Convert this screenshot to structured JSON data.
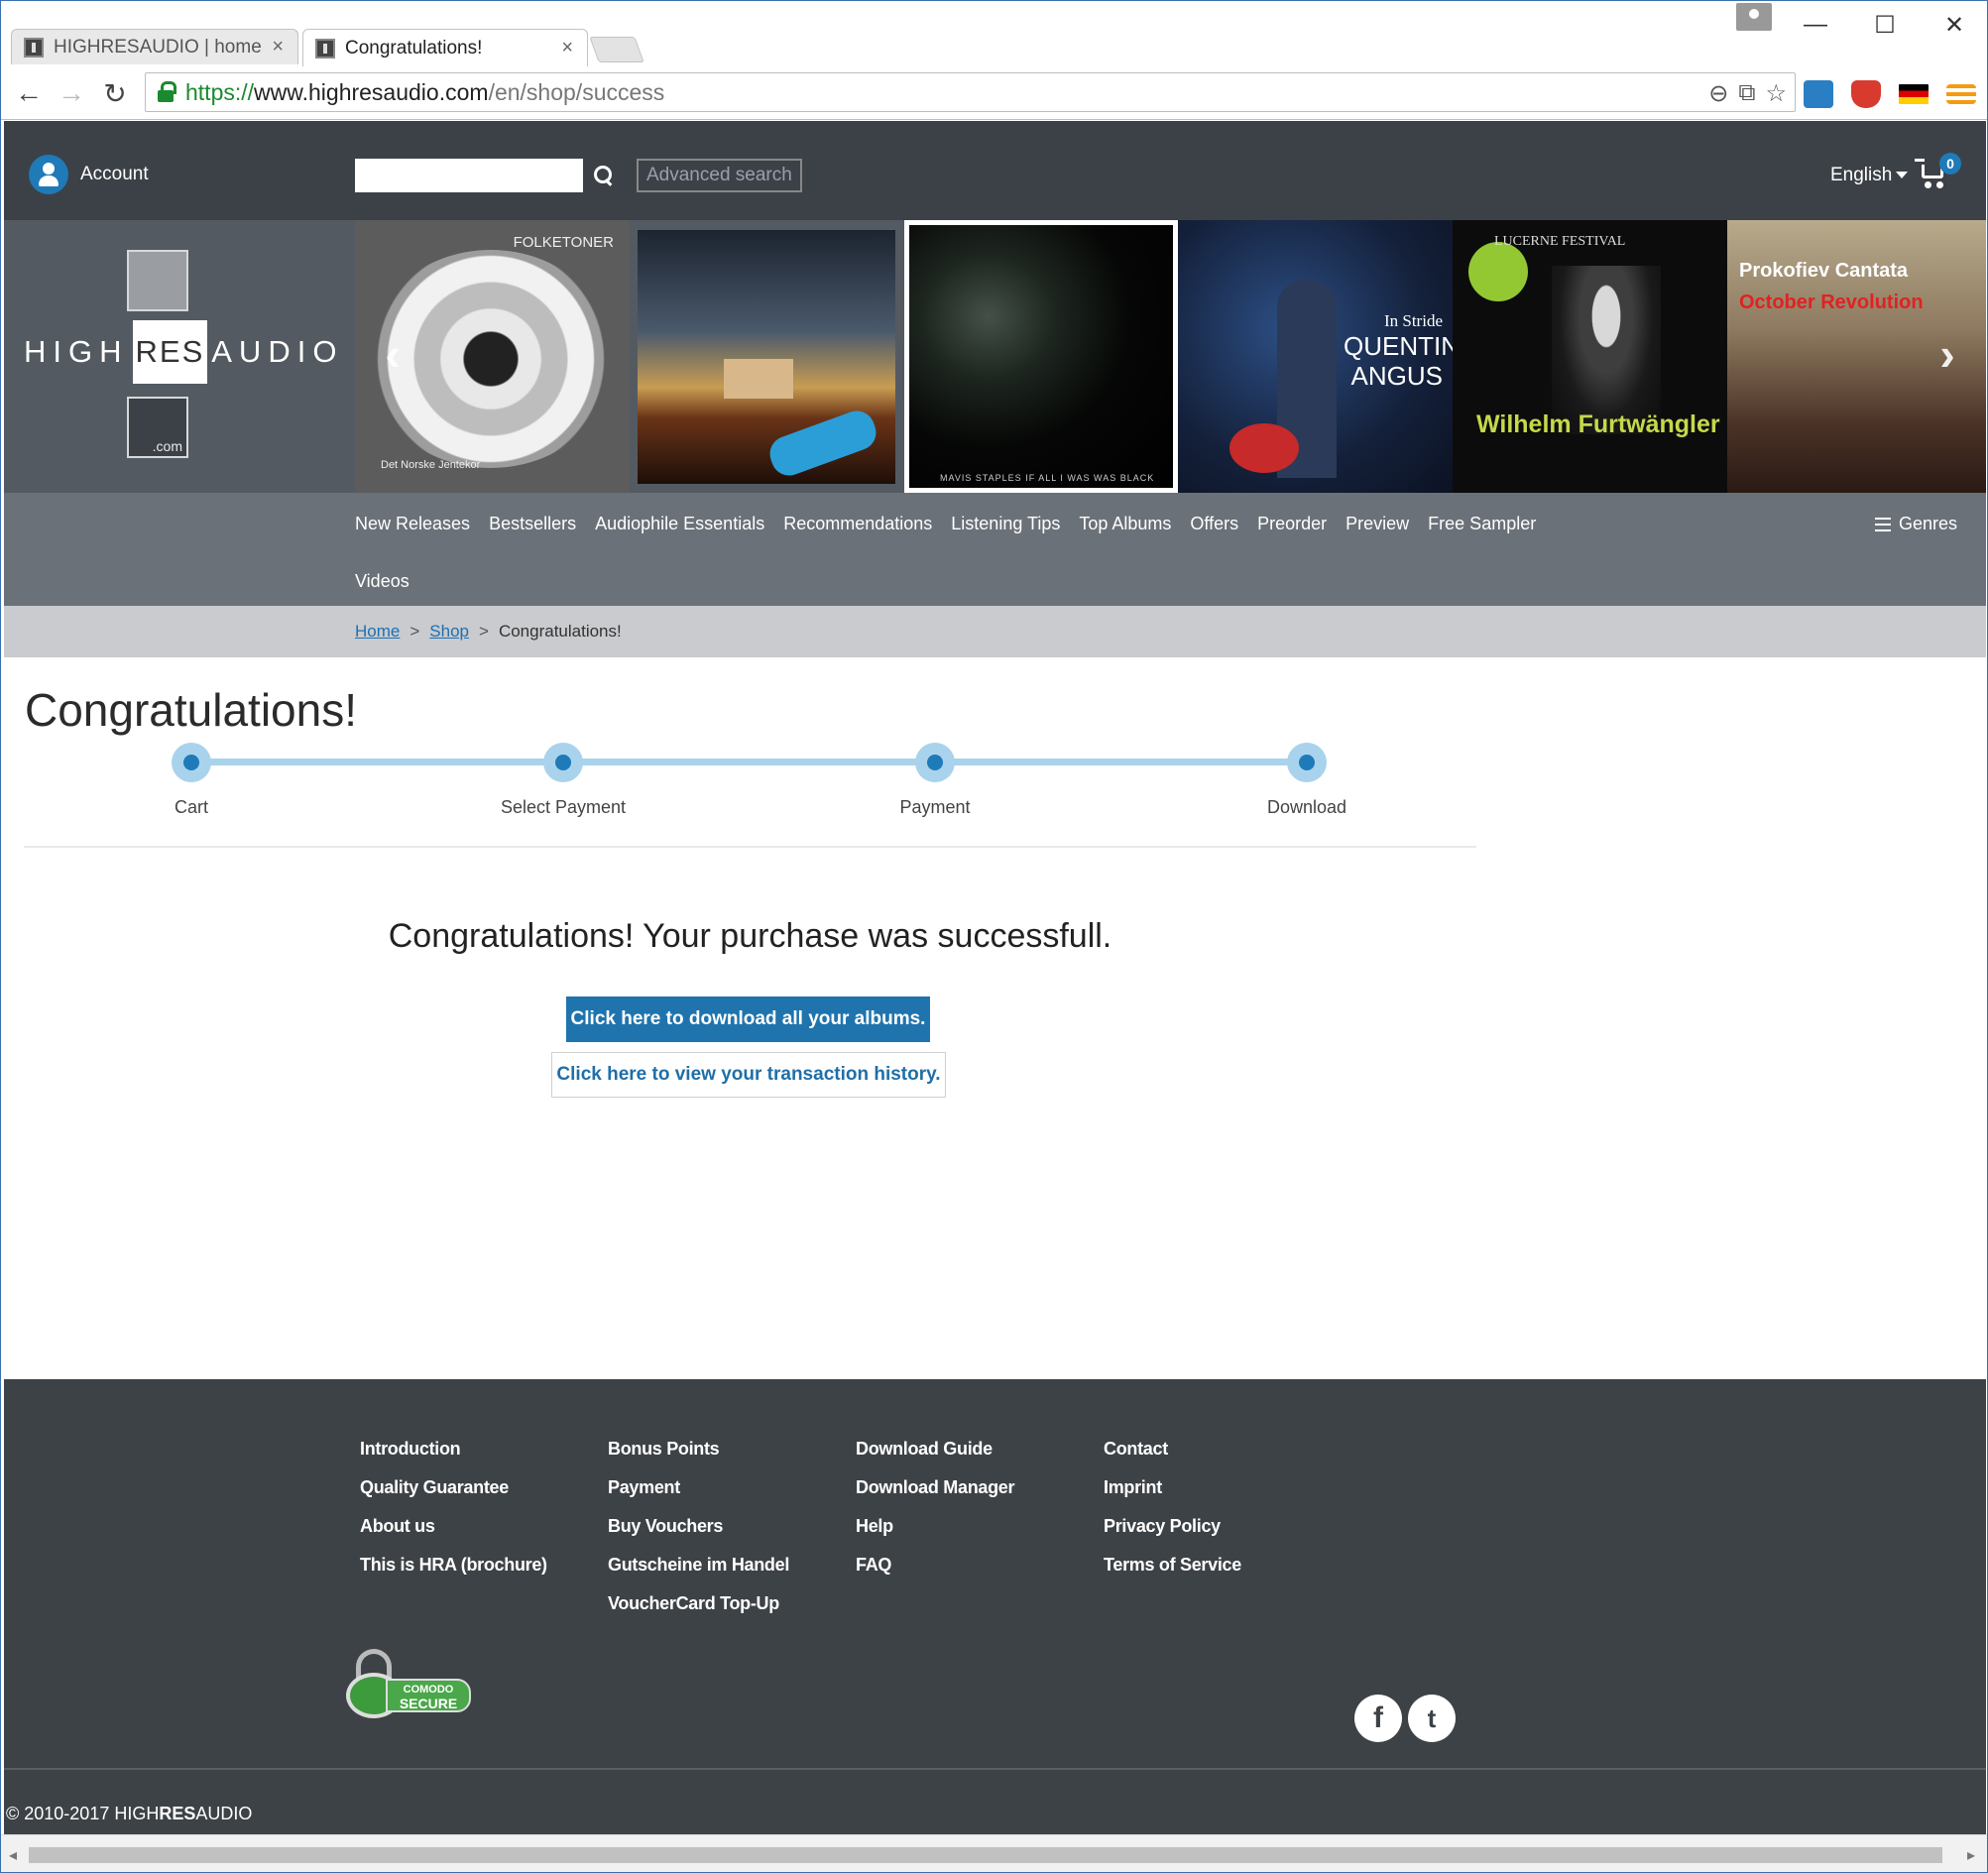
{
  "browser": {
    "tabs": [
      {
        "title": "HIGHRESAUDIO | home of",
        "close": "×"
      },
      {
        "title": "Congratulations!",
        "close": "×"
      }
    ],
    "window_controls": {
      "minimize": "—",
      "maximize": "☐",
      "close": "✕"
    },
    "url": {
      "scheme": "https://",
      "host": "www.highresaudio.com",
      "path": "/en/shop/success"
    }
  },
  "header": {
    "account_label": "Account",
    "search_placeholder": "",
    "advanced_search": "Advanced search",
    "language": "English",
    "cart_count": "0"
  },
  "logo": {
    "left": "HIGH",
    "mid": "RES",
    "right": "AUDIO",
    "dotcom": ".com"
  },
  "carousel": [
    {
      "title": "FOLKETONER",
      "subtitle": "Det Norske Jentekor"
    },
    {
      "title": "",
      "subtitle": ""
    },
    {
      "title": "MAVIS STAPLES  IF ALL I WAS WAS BLACK",
      "subtitle": ""
    },
    {
      "title": "In Stride",
      "subtitle": "QUENTIN ANGUS"
    },
    {
      "title": "LUCERNE FESTIVAL",
      "subtitle": "Wilhelm Furtwängler"
    },
    {
      "title": "Prokofiev Cantata",
      "subtitle": "October Revolution"
    }
  ],
  "nav": {
    "items": [
      "New Releases",
      "Bestsellers",
      "Audiophile Essentials",
      "Recommendations",
      "Listening Tips",
      "Top Albums",
      "Offers",
      "Preorder",
      "Preview",
      "Free Sampler",
      "Videos"
    ],
    "genres": "Genres"
  },
  "breadcrumb": {
    "home": "Home",
    "shop": "Shop",
    "current": "Congratulations!",
    "sep": ">"
  },
  "page": {
    "title": "Congratulations!",
    "steps": [
      "Cart",
      "Select Payment",
      "Payment",
      "Download"
    ],
    "message": "Congratulations! Your purchase was successfull.",
    "download_button": "Click here to download all your albums.",
    "history_button": "Click here to view your transaction history."
  },
  "footer": {
    "col1": [
      "Introduction",
      "Quality Guarantee",
      "About us",
      "This is HRA (brochure)"
    ],
    "col2": [
      "Bonus Points",
      "Payment",
      "Buy Vouchers",
      "Gutscheine im Handel",
      "VoucherCard Top-Up"
    ],
    "col3": [
      "Download Guide",
      "Download Manager",
      "Help",
      "FAQ"
    ],
    "col4": [
      "Contact",
      "Imprint",
      "Privacy Policy",
      "Terms of Service"
    ],
    "comodo": {
      "top": "COMODO",
      "bottom": "SECURE"
    },
    "copyright_prefix": "© 2010-2017 HIGH",
    "copyright_res": "RES",
    "copyright_suffix": "AUDIO"
  },
  "colors": {
    "header_bg": "#3c4147",
    "nav_bg": "#6b7178",
    "accent": "#1f74ad",
    "step_track": "#a9d3ec"
  }
}
